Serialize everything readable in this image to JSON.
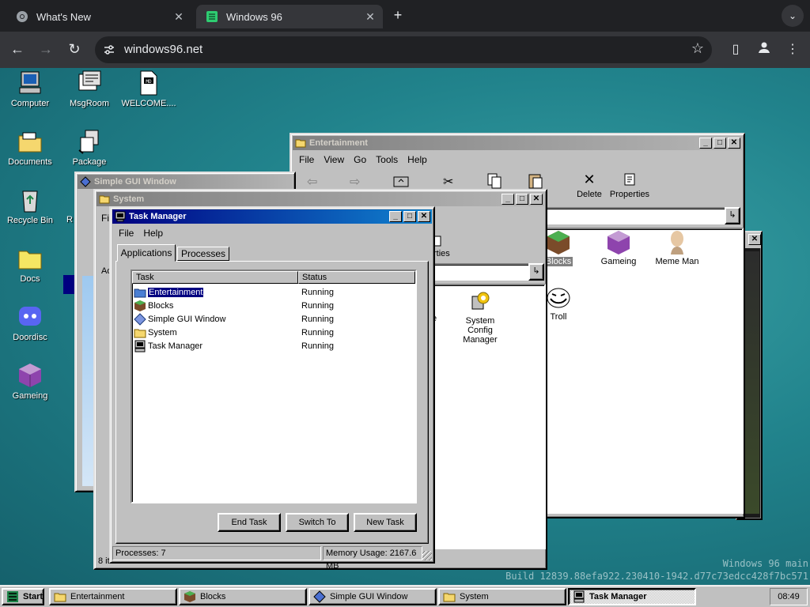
{
  "browser": {
    "tabs": [
      {
        "title": "What's New",
        "active": false
      },
      {
        "title": "Windows 96",
        "active": true
      }
    ],
    "url": "windows96.net"
  },
  "desktop": {
    "icons": [
      {
        "label": "Computer",
        "icon": "computer-icon"
      },
      {
        "label": "MsgRoom",
        "icon": "msgroom-icon"
      },
      {
        "label": "WELCOME....",
        "icon": "document-icon"
      },
      {
        "label": "Documents",
        "icon": "folder-icon"
      },
      {
        "label": "Package",
        "icon": "package-icon"
      },
      {
        "label": "Recycle Bin",
        "icon": "recycle-bin-icon"
      },
      {
        "label": "Docs",
        "icon": "folder-icon"
      },
      {
        "label": "Doordisc",
        "icon": "doordisc-icon"
      },
      {
        "label": "Gameing",
        "icon": "gameing-cube-icon"
      }
    ],
    "watermark_line1": "Windows 96 main",
    "watermark_line2": "Build 12839.88efa922.230410-1942.d77c73edcc428f7bc571"
  },
  "entertainment": {
    "title": "Entertainment",
    "menu": [
      "File",
      "View",
      "Go",
      "Tools",
      "Help"
    ],
    "toolbar": [
      {
        "label": "Delete",
        "icon": "cut-x-icon"
      },
      {
        "label": "Properties",
        "icon": "properties-icon"
      }
    ],
    "items": [
      {
        "label": "Blocks",
        "icon": "blocks-icon"
      },
      {
        "label": "Gameing",
        "icon": "gameing-cube-icon"
      },
      {
        "label": "Meme Man",
        "icon": "meme-man-icon"
      },
      {
        "label": "Troll",
        "icon": "trollface-icon"
      }
    ]
  },
  "simple_gui": {
    "title": "Simple GUI Window"
  },
  "system": {
    "title": "System",
    "menu_visible": "Fil",
    "toolbar_partial": "rties",
    "address_partial": "Ad",
    "config_manager_label": "System Config Manager",
    "partial_item_label": "e",
    "status_items": "8 items"
  },
  "task_manager": {
    "title": "Task Manager",
    "menu": [
      "File",
      "Help"
    ],
    "tabs": [
      "Applications",
      "Processes"
    ],
    "columns": [
      "Task",
      "Status"
    ],
    "tasks": [
      {
        "name": "Entertainment",
        "status": "Running",
        "icon": "folder-blue-icon",
        "selected": true
      },
      {
        "name": "Blocks",
        "status": "Running",
        "icon": "blocks-icon",
        "selected": false
      },
      {
        "name": "Simple GUI Window",
        "status": "Running",
        "icon": "diamond-icon",
        "selected": false
      },
      {
        "name": "System",
        "status": "Running",
        "icon": "folder-icon",
        "selected": false
      },
      {
        "name": "Task Manager",
        "status": "Running",
        "icon": "task-manager-icon",
        "selected": false
      }
    ],
    "buttons": {
      "end_task": "End Task",
      "switch_to": "Switch To",
      "new_task": "New Task"
    },
    "status_processes": "Processes: 7",
    "status_memory": "Memory Usage: 2167.6 MB"
  },
  "taskbar": {
    "start_label": "Start",
    "tasks": [
      {
        "label": "Entertainment",
        "icon": "folder-icon"
      },
      {
        "label": "Blocks",
        "icon": "blocks-icon"
      },
      {
        "label": "Simple GUI Window",
        "icon": "diamond-icon"
      },
      {
        "label": "System",
        "icon": "folder-icon"
      },
      {
        "label": "Task Manager",
        "icon": "task-manager-icon",
        "pressed": true
      }
    ],
    "clock": "08:49"
  }
}
